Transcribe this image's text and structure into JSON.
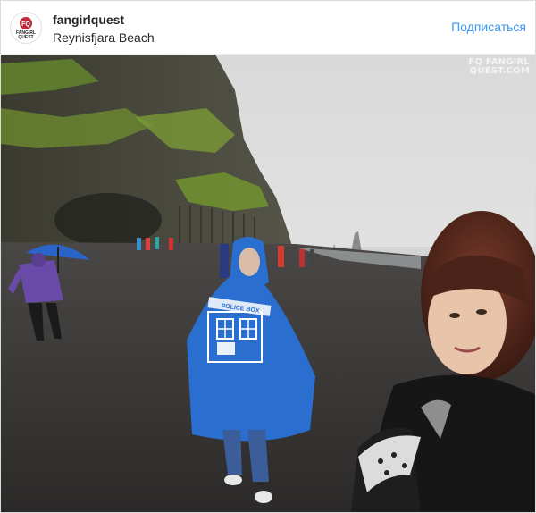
{
  "post": {
    "username": "fangirlquest",
    "location": "Reynisfjara Beach",
    "follow_label": "Подписаться",
    "avatar_text": [
      "FQ",
      "FANGIRL",
      "QUEST"
    ]
  },
  "photo": {
    "watermark_line1": "FQ FANGIRL",
    "watermark_line2": "QUEST.COM",
    "poncho_sign": "POLICE BOX"
  },
  "colors": {
    "accent": "#3897f0",
    "brand_red": "#c0283c",
    "poncho_blue": "#2a6fd0",
    "sky": "#e4e4e4",
    "sand": "#3a3836"
  }
}
